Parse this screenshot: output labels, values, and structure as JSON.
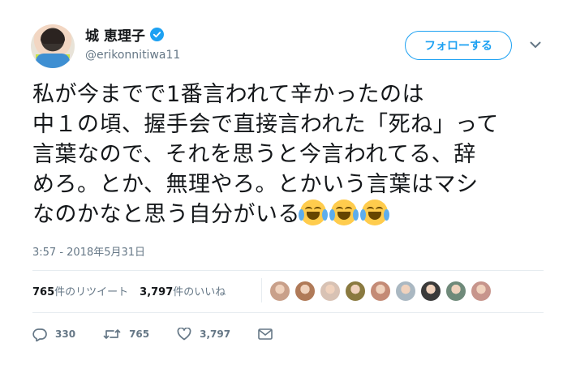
{
  "user": {
    "display_name": "城 恵理子",
    "handle": "@erikonnitiwa11",
    "verified": true
  },
  "follow_button": {
    "label": "フォローする"
  },
  "tweet": {
    "lines": [
      "私が今までで1番言われて辛かったのは",
      "中１の頃、握手会で直接言われた「死ね」って",
      "言葉なので、それを思うと今言われてる、辞",
      "めろ。とか、無理やろ。とかいう言葉はマシ",
      "なのかなと思う自分がいる"
    ],
    "emoji_count": 3,
    "emoji": "face-with-tears-of-joy-icon"
  },
  "timestamp": "3:57 - 2018年5月31日",
  "stats": {
    "retweets_count": "765",
    "retweets_label": "件のリツイート",
    "likes_count": "3,797",
    "likes_label": "件のいいね"
  },
  "likers": [
    {
      "color": "#c9a08a"
    },
    {
      "color": "#b07a58"
    },
    {
      "color": "#d8c2b4"
    },
    {
      "color": "#8a7a40"
    },
    {
      "color": "#c48b76"
    },
    {
      "color": "#aab8c2"
    },
    {
      "color": "#3a3a3a"
    },
    {
      "color": "#6f8a7a"
    },
    {
      "color": "#c7958c"
    }
  ],
  "actions": {
    "replies": "330",
    "retweets": "765",
    "likes": "3,797"
  },
  "colors": {
    "accent": "#1da1f2",
    "text": "#14171a",
    "muted": "#657786"
  }
}
